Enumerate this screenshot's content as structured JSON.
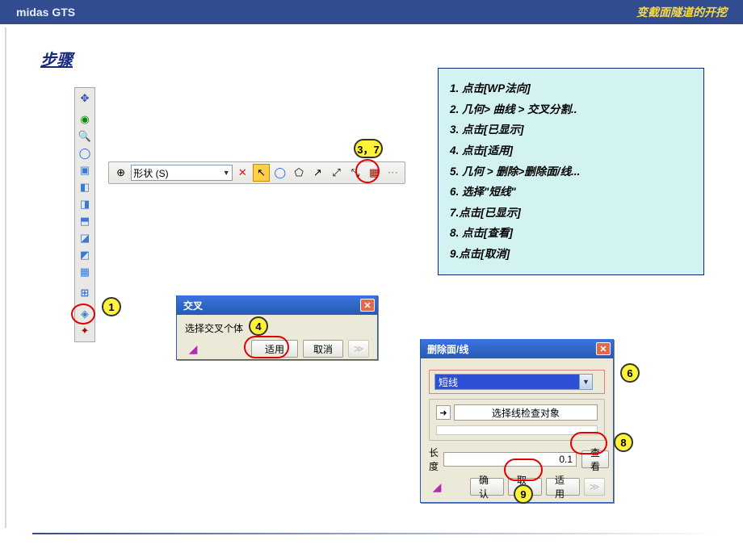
{
  "header": {
    "left": "midas GTS",
    "right": "变截面隧道的开挖"
  },
  "steps_title": "步骤",
  "instructions": [
    "1. 点击[WP法向]",
    "2. 几何> 曲线 > 交叉分割..",
    "3. 点击[已显示]",
    "4. 点击[适用]",
    "5. 几何 > 删除>删除面/线...",
    "6. 选择\"短线\"",
    "7.点击[已显示]",
    "8. 点击[查看]",
    "9.点击[取消]"
  ],
  "toolbar": {
    "shape_label": "形状 (S)"
  },
  "callouts": {
    "c1": "1",
    "c37": "3，7",
    "c4": "4",
    "c6": "6",
    "c8": "8",
    "c9": "9"
  },
  "dialog_cross": {
    "title": "交叉",
    "label": "选择交叉个体",
    "apply": "适用",
    "cancel": "取消"
  },
  "dialog_delete": {
    "title": "删除面/线",
    "combo_value": "短线",
    "select_label": "选择线检查对象",
    "length_label": "长度",
    "length_value": "0.1",
    "view": "查看",
    "ok": "确认",
    "cancel": "取消",
    "apply": "适用"
  }
}
